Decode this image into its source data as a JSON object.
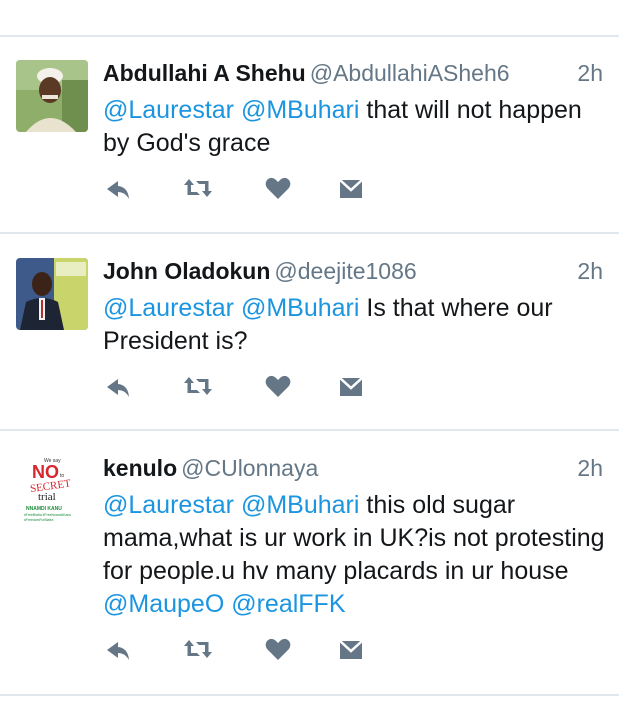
{
  "tweets": [
    {
      "name": "Abdullahi A Shehu",
      "handle": "@AbdullahiASheh6",
      "time": "2h",
      "text": [
        {
          "t": "@Laurestar",
          "mention": true
        },
        {
          "t": " ",
          "mention": false
        },
        {
          "t": "@MBuhari",
          "mention": true
        },
        {
          "t": " that will not happen by God's grace",
          "mention": false
        }
      ]
    },
    {
      "name": "John Oladokun",
      "handle": "@deejite1086",
      "time": "2h",
      "text": [
        {
          "t": "@Laurestar",
          "mention": true
        },
        {
          "t": " ",
          "mention": false
        },
        {
          "t": "@MBuhari",
          "mention": true
        },
        {
          "t": " Is that where our President is?",
          "mention": false
        }
      ]
    },
    {
      "name": "kenulo",
      "handle": "@CUlonnaya",
      "time": "2h",
      "avatar": {
        "top": "We say",
        "no": "NO",
        "to": "to",
        "secret": "SECRET",
        "trial": "trial",
        "name": "NNAMDI KANU",
        "tag1": "#FreeBiafra #FreeNnamdiKanu",
        "tag2": "#FreedomForBiafra"
      },
      "text": [
        {
          "t": "@Laurestar",
          "mention": true
        },
        {
          "t": " ",
          "mention": false
        },
        {
          "t": "@MBuhari",
          "mention": true
        },
        {
          "t": " this old sugar mama,what is ur work in UK?is not protesting for people.u hv many placards in ur house ",
          "mention": false
        },
        {
          "t": "@MaupeO",
          "mention": true
        },
        {
          "t": " ",
          "mention": false
        },
        {
          "t": "@realFFK",
          "mention": true
        }
      ]
    }
  ],
  "actions": [
    {
      "name": "reply-icon",
      "icon": "reply"
    },
    {
      "name": "retweet-icon",
      "icon": "retweet"
    },
    {
      "name": "like-icon",
      "icon": "heart"
    },
    {
      "name": "direct-message-icon",
      "icon": "envelope"
    }
  ],
  "colors": {
    "mention": "#1b95e0",
    "secondary_text": "#657786",
    "icon": "#657786",
    "divider": "#e1e8ed"
  }
}
